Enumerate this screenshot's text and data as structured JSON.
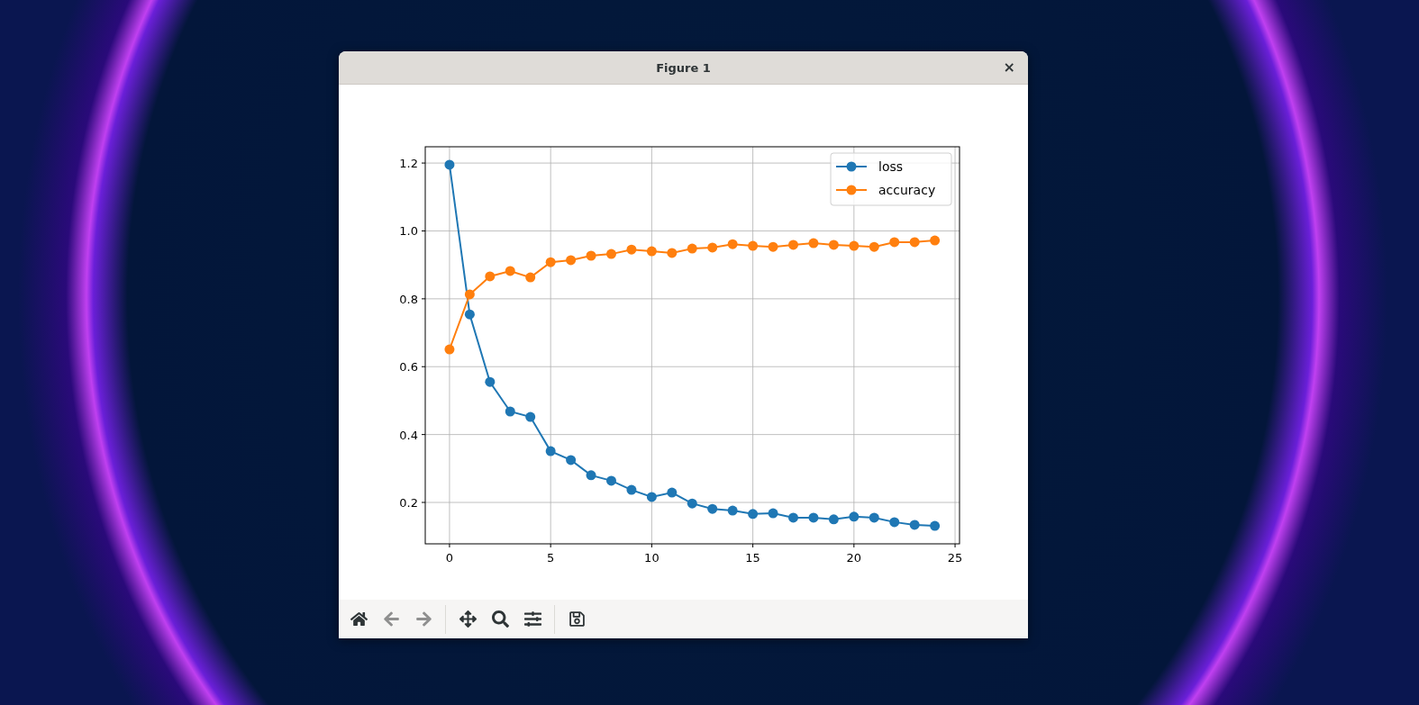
{
  "window": {
    "title": "Figure 1",
    "close": "×"
  },
  "figure": {
    "chart_data": {
      "type": "line",
      "x": [
        0,
        1,
        2,
        3,
        4,
        5,
        6,
        7,
        8,
        9,
        10,
        11,
        12,
        13,
        14,
        15,
        16,
        17,
        18,
        19,
        20,
        21,
        22,
        23,
        24
      ],
      "series": [
        {
          "name": "loss",
          "color": "#1f77b4",
          "marker": "o",
          "values": [
            1.195,
            0.754,
            0.555,
            0.468,
            0.452,
            0.351,
            0.325,
            0.28,
            0.264,
            0.237,
            0.216,
            0.229,
            0.197,
            0.181,
            0.176,
            0.166,
            0.168,
            0.155,
            0.155,
            0.15,
            0.158,
            0.155,
            0.142,
            0.134,
            0.131
          ]
        },
        {
          "name": "accuracy",
          "color": "#ff7f0e",
          "marker": "o",
          "values": [
            0.651,
            0.813,
            0.866,
            0.882,
            0.863,
            0.908,
            0.914,
            0.927,
            0.932,
            0.945,
            0.94,
            0.935,
            0.948,
            0.951,
            0.961,
            0.956,
            0.953,
            0.959,
            0.964,
            0.959,
            0.956,
            0.953,
            0.967,
            0.967,
            0.972
          ]
        }
      ],
      "grid": true,
      "legend": true,
      "xlim": [
        -1.2,
        25.22
      ],
      "ylim": [
        0.078,
        1.248
      ],
      "xticks": [
        0,
        5,
        10,
        15,
        20,
        25
      ],
      "yticks": [
        {
          "value": 0.2,
          "label": "0.2"
        },
        {
          "value": 0.4,
          "label": "0.4"
        },
        {
          "value": 0.6,
          "label": "0.6"
        },
        {
          "value": 0.8,
          "label": "0.8"
        },
        {
          "value": 1.0,
          "label": "1.0"
        },
        {
          "value": 1.2,
          "label": "1.2"
        }
      ]
    }
  },
  "toolbar": {
    "groups": [
      [
        {
          "kind": "home",
          "disabled": false
        },
        {
          "kind": "back",
          "disabled": true
        },
        {
          "kind": "forward",
          "disabled": true
        }
      ],
      [
        {
          "kind": "pan",
          "disabled": false
        },
        {
          "kind": "zoom",
          "disabled": false
        },
        {
          "kind": "configure",
          "disabled": false
        }
      ],
      [
        {
          "kind": "save",
          "disabled": false
        }
      ]
    ]
  }
}
